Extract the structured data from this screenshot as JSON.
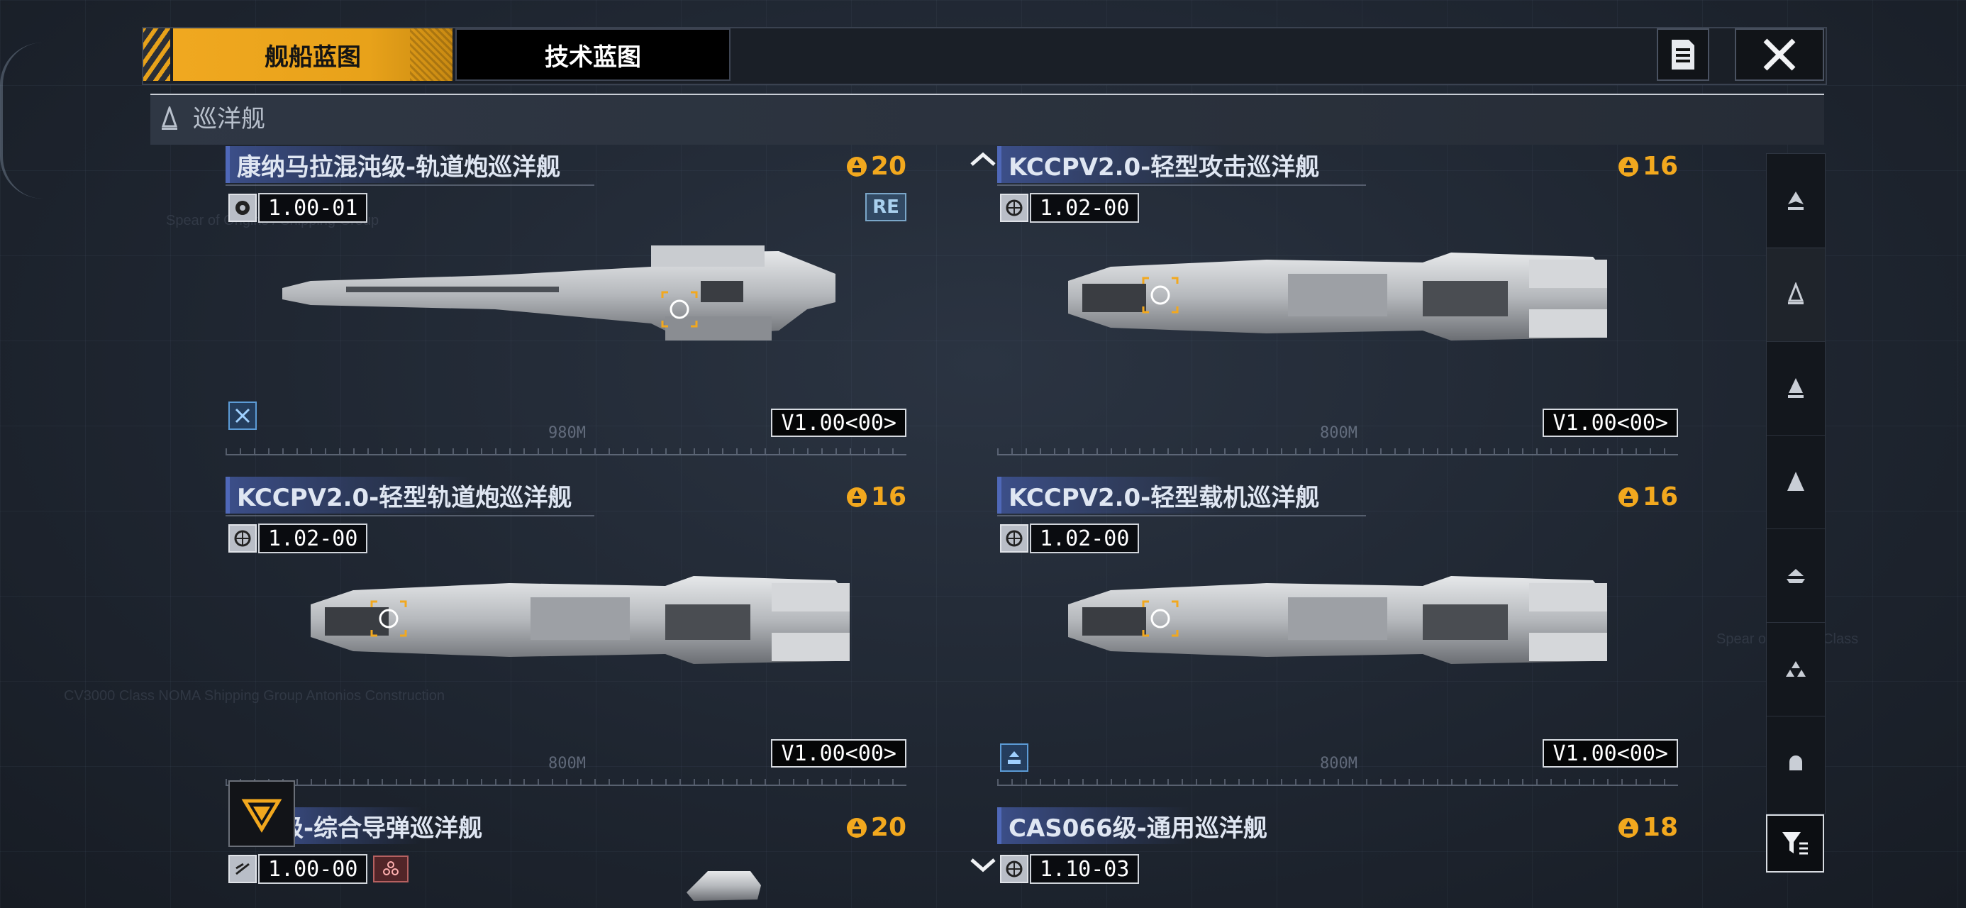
{
  "tabs": {
    "ship_blueprint": "舰船蓝图",
    "tech_blueprint": "技术蓝图"
  },
  "category": {
    "label": "巡洋舰"
  },
  "cards": [
    {
      "title": "康纳马拉混沌级-轨道炮巡洋舰",
      "cost": "20",
      "version": "1.00-01",
      "badge": "RE",
      "model": "V1.00<00>",
      "distance": "980M"
    },
    {
      "title": "KCCPV2.0-轻型攻击巡洋舰",
      "cost": "16",
      "version": "1.02-00",
      "badge": "",
      "model": "V1.00<00>",
      "distance": "800M"
    },
    {
      "title": "KCCPV2.0-轻型轨道炮巡洋舰",
      "cost": "16",
      "version": "1.02-00",
      "badge": "",
      "model": "V1.00<00>",
      "distance": "800M"
    },
    {
      "title": "KCCPV2.0-轻型载机巡洋舰",
      "cost": "16",
      "version": "1.02-00",
      "badge": "",
      "model": "V1.00<00>",
      "distance": "800M"
    },
    {
      "title": "级-综合导弹巡洋舰",
      "cost": "20",
      "version": "1.00-00",
      "badge": "",
      "model": "",
      "distance": ""
    },
    {
      "title": "CAS066级-通用巡洋舰",
      "cost": "18",
      "version": "1.10-03",
      "badge": "",
      "model": "",
      "distance": ""
    }
  ],
  "sidebar": {
    "items": [
      "frigate-class-icon",
      "cruiser-class-icon",
      "destroyer-class-icon",
      "battleship-class-icon",
      "carrier-class-icon",
      "fleet-class-icon",
      "support-class-icon"
    ],
    "selected_index": 1
  },
  "colors": {
    "accent": "#f0a820",
    "title_band": "#3c4f8a",
    "background": "#1f2631"
  }
}
